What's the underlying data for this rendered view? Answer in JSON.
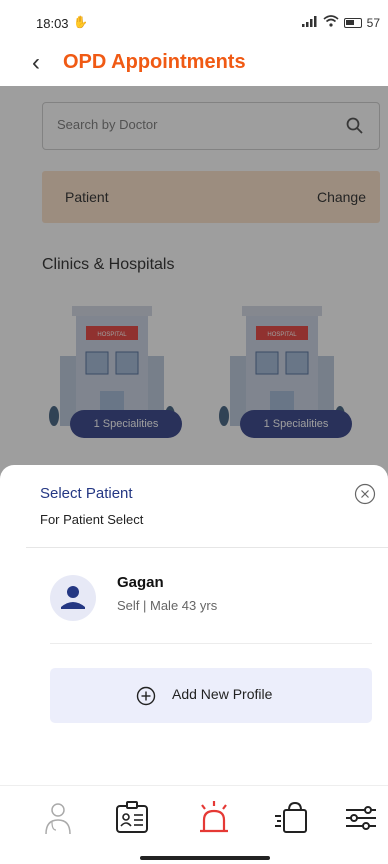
{
  "status_bar": {
    "time": "18:03",
    "battery": "57"
  },
  "header": {
    "title": "OPD Appointments",
    "back_icon": "chevron-left-icon"
  },
  "search": {
    "placeholder": "Search by Doctor",
    "icon": "search-icon"
  },
  "patient_strip": {
    "label": "Patient",
    "action": "Change"
  },
  "clinics": {
    "title": "Clinics & Hospitals",
    "cards": [
      {
        "badge": "1 Specialities",
        "sign": "HOSPITAL"
      },
      {
        "badge": "1 Specialities",
        "sign": "HOSPITAL"
      }
    ]
  },
  "sheet": {
    "title": "Select Patient",
    "subtitle": "For Patient Select",
    "close_icon": "close-circle-icon",
    "patient": {
      "name": "Gagan",
      "details": "Self | Male 43 yrs",
      "avatar_icon": "person-icon"
    },
    "add_profile": {
      "label": "Add New Profile",
      "icon": "plus-circle-icon"
    }
  },
  "bottom_nav": [
    {
      "icon": "doctor-icon"
    },
    {
      "icon": "id-card-icon"
    },
    {
      "icon": "emergency-alarm-icon",
      "active": true
    },
    {
      "icon": "shopping-bag-icon"
    },
    {
      "icon": "settings-sliders-icon"
    }
  ],
  "colors": {
    "accent": "#f05a14",
    "navy": "#243783",
    "badge": "#2b3a83",
    "strip": "#fbe0c6",
    "active_nav": "#e53935"
  }
}
